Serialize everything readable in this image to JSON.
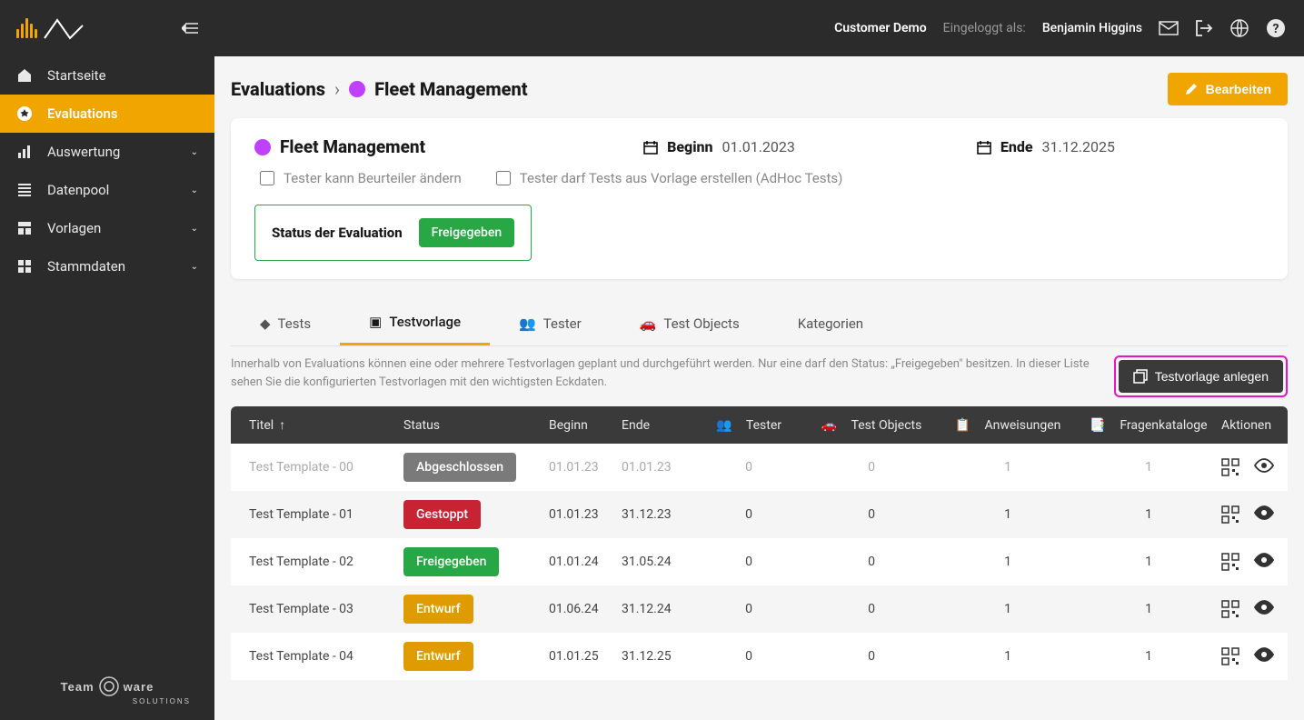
{
  "header": {
    "customer": "Customer Demo",
    "logged_label": "Eingeloggt als:",
    "user": "Benjamin Higgins"
  },
  "sidebar": {
    "items": [
      {
        "icon": "home",
        "label": "Startseite",
        "expandable": false
      },
      {
        "icon": "star",
        "label": "Evaluations",
        "expandable": false,
        "active": true
      },
      {
        "icon": "chart",
        "label": "Auswertung",
        "expandable": true
      },
      {
        "icon": "list",
        "label": "Datenpool",
        "expandable": true
      },
      {
        "icon": "template",
        "label": "Vorlagen",
        "expandable": true
      },
      {
        "icon": "master",
        "label": "Stammdaten",
        "expandable": true
      }
    ]
  },
  "breadcrumb": {
    "root": "Evaluations",
    "current": "Fleet Management",
    "edit_button": "Bearbeiten"
  },
  "card": {
    "title": "Fleet Management",
    "begin_label": "Beginn",
    "begin_value": "01.01.2023",
    "end_label": "Ende",
    "end_value": "31.12.2025",
    "checkbox1": "Tester kann Beurteiler ändern",
    "checkbox2": "Tester darf Tests aus Vorlage erstellen (AdHoc Tests)",
    "status_label": "Status der Evaluation",
    "status_value": "Freigegeben"
  },
  "tabs": [
    {
      "label": "Tests",
      "icon": "diamond"
    },
    {
      "label": "Testvorlage",
      "icon": "stack",
      "active": true
    },
    {
      "label": "Tester",
      "icon": "people"
    },
    {
      "label": "Test Objects",
      "icon": "car"
    },
    {
      "label": "Kategorien",
      "icon": ""
    }
  ],
  "helper_text": "Innerhalb von Evaluations können eine oder mehrere Testvorlagen geplant und durchgeführt werden. Nur eine darf den Status: „Freigegeben\" besitzen. In dieser Liste sehen Sie die konfigurierten Testvorlagen mit den wichtigsten Eckdaten.",
  "create_button": "Testvorlage anlegen",
  "table": {
    "columns": {
      "title": "Titel",
      "status": "Status",
      "begin": "Beginn",
      "end": "Ende",
      "tester": "Tester",
      "objects": "Test Objects",
      "instructions": "Anweisungen",
      "catalogs": "Fragenkataloge",
      "actions": "Aktionen"
    },
    "rows": [
      {
        "title": "Test Template - 00",
        "status": "Abgeschlossen",
        "status_class": "b-gray",
        "begin": "01.01.23",
        "end": "01.01.23",
        "tester": "0",
        "objects": "0",
        "instructions": "1",
        "catalogs": "1",
        "inactive": true
      },
      {
        "title": "Test Template - 01",
        "status": "Gestoppt",
        "status_class": "b-red",
        "begin": "01.01.23",
        "end": "31.12.23",
        "tester": "0",
        "objects": "0",
        "instructions": "1",
        "catalogs": "1"
      },
      {
        "title": "Test Template - 02",
        "status": "Freigegeben",
        "status_class": "b-green",
        "begin": "01.01.24",
        "end": "31.05.24",
        "tester": "0",
        "objects": "0",
        "instructions": "1",
        "catalogs": "1"
      },
      {
        "title": "Test Template - 03",
        "status": "Entwurf",
        "status_class": "b-yellow",
        "begin": "01.06.24",
        "end": "31.12.24",
        "tester": "0",
        "objects": "0",
        "instructions": "1",
        "catalogs": "1"
      },
      {
        "title": "Test Template - 04",
        "status": "Entwurf",
        "status_class": "b-yellow",
        "begin": "01.01.25",
        "end": "31.12.25",
        "tester": "0",
        "objects": "0",
        "instructions": "1",
        "catalogs": "1"
      }
    ]
  }
}
